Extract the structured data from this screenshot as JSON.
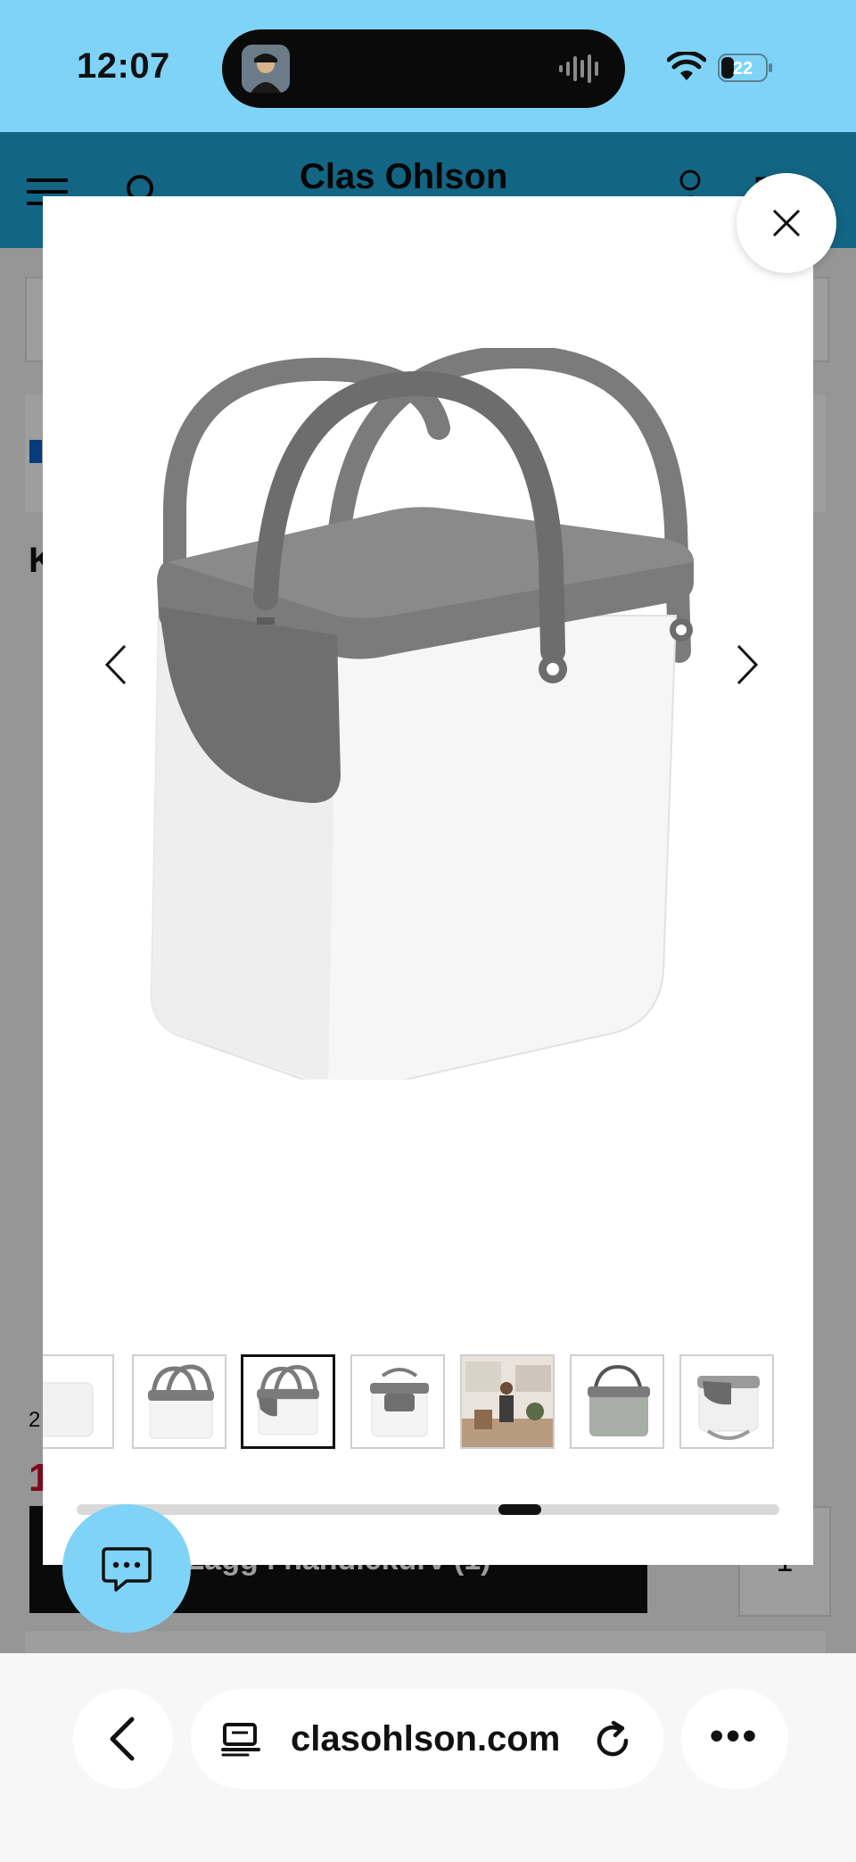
{
  "status_bar": {
    "time": "12:07",
    "battery_level": "22",
    "icons": [
      "now-playing-avatar",
      "audio-waveform-icon",
      "wifi-icon",
      "battery-icon"
    ]
  },
  "background_page": {
    "header": {
      "logo_text": "Clas Ohlson",
      "icons": [
        "menu-icon",
        "search-icon",
        "account-icon",
        "cart-icon"
      ],
      "color": "#1fa3d6"
    },
    "product_title_initial": "K",
    "old_price_initial": "2",
    "price_initial": "1",
    "add_to_cart_label": "Lägg i handlekurv (1)",
    "quantity": "1"
  },
  "gallery": {
    "thumbnails_count": 7,
    "active_thumbnail_index": 2,
    "scroll_position": 0.77,
    "icons": [
      "chevron-left-icon",
      "chevron-right-icon",
      "close-icon"
    ]
  },
  "chat": {
    "icon": "chat-bubble-icon",
    "color": "#7fd3f7"
  },
  "browser": {
    "url": "clasohlson.com",
    "icons": [
      "back-arrow-icon",
      "page-tabs-icon",
      "reload-icon",
      "more-icon"
    ],
    "more_label": "•••"
  },
  "colors": {
    "status_bar": "#7fd3f7",
    "accent_black": "#111111",
    "product_grey": "#7b7b7b"
  }
}
